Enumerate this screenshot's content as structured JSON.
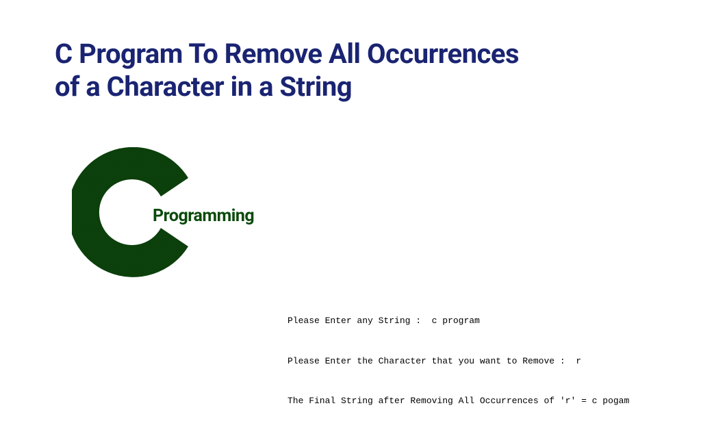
{
  "title": "C Program To Remove All Occurrences\nof a Character in a String",
  "logo": {
    "text": "Programming"
  },
  "output": {
    "line1": "Please Enter any String :  c program",
    "line2": "Please Enter the Character that you want to Remove :  r",
    "line3": "The Final String after Removing All Occurrences of 'r' = c pogam"
  }
}
